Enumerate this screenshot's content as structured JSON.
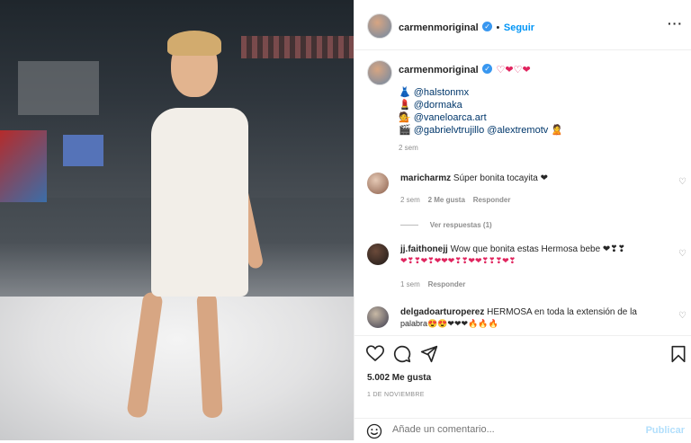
{
  "post": {
    "username": "carmenmoriginal",
    "follow_label": "Seguir",
    "more_label": "···"
  },
  "caption": {
    "username": "carmenmoriginal",
    "hearts": "♡❤♡❤",
    "credits": [
      {
        "emoji": "👗",
        "handle": "@halstonmx"
      },
      {
        "emoji": "💄",
        "handle": "@dormaka"
      },
      {
        "emoji": "💁",
        "handle": "@vaneloarca.art"
      },
      {
        "emoji": "🎬",
        "handle": "@gabrielvtrujillo @alextremotv 🙎"
      }
    ],
    "time": "2 sem"
  },
  "comments": [
    {
      "user": "maricharmz",
      "text": "Súper bonita tocayita ❤",
      "time": "2 sem",
      "likes": "2 Me gusta",
      "reply": "Responder"
    },
    {
      "replies_label": "Ver respuestas (1)"
    },
    {
      "user": "jj.faithonejj",
      "text": "Wow que bonita estas Hermosa bebe ❤❣❣",
      "text2": "❤❣❣❤❣❤❤❤❣❣❤❤❣❣❣❤❣",
      "time": "1 sem",
      "reply": "Responder"
    },
    {
      "user": "delgadoarturoperez",
      "text": "HERMOSA en toda la extensión de la",
      "text2": "palabra😍😍❤❤❤🔥🔥🔥"
    }
  ],
  "footer": {
    "likes": "5.002 Me gusta",
    "date": "1 DE NOVIEMBRE",
    "comment_placeholder": "Añade un comentario...",
    "publish_label": "Publicar"
  }
}
